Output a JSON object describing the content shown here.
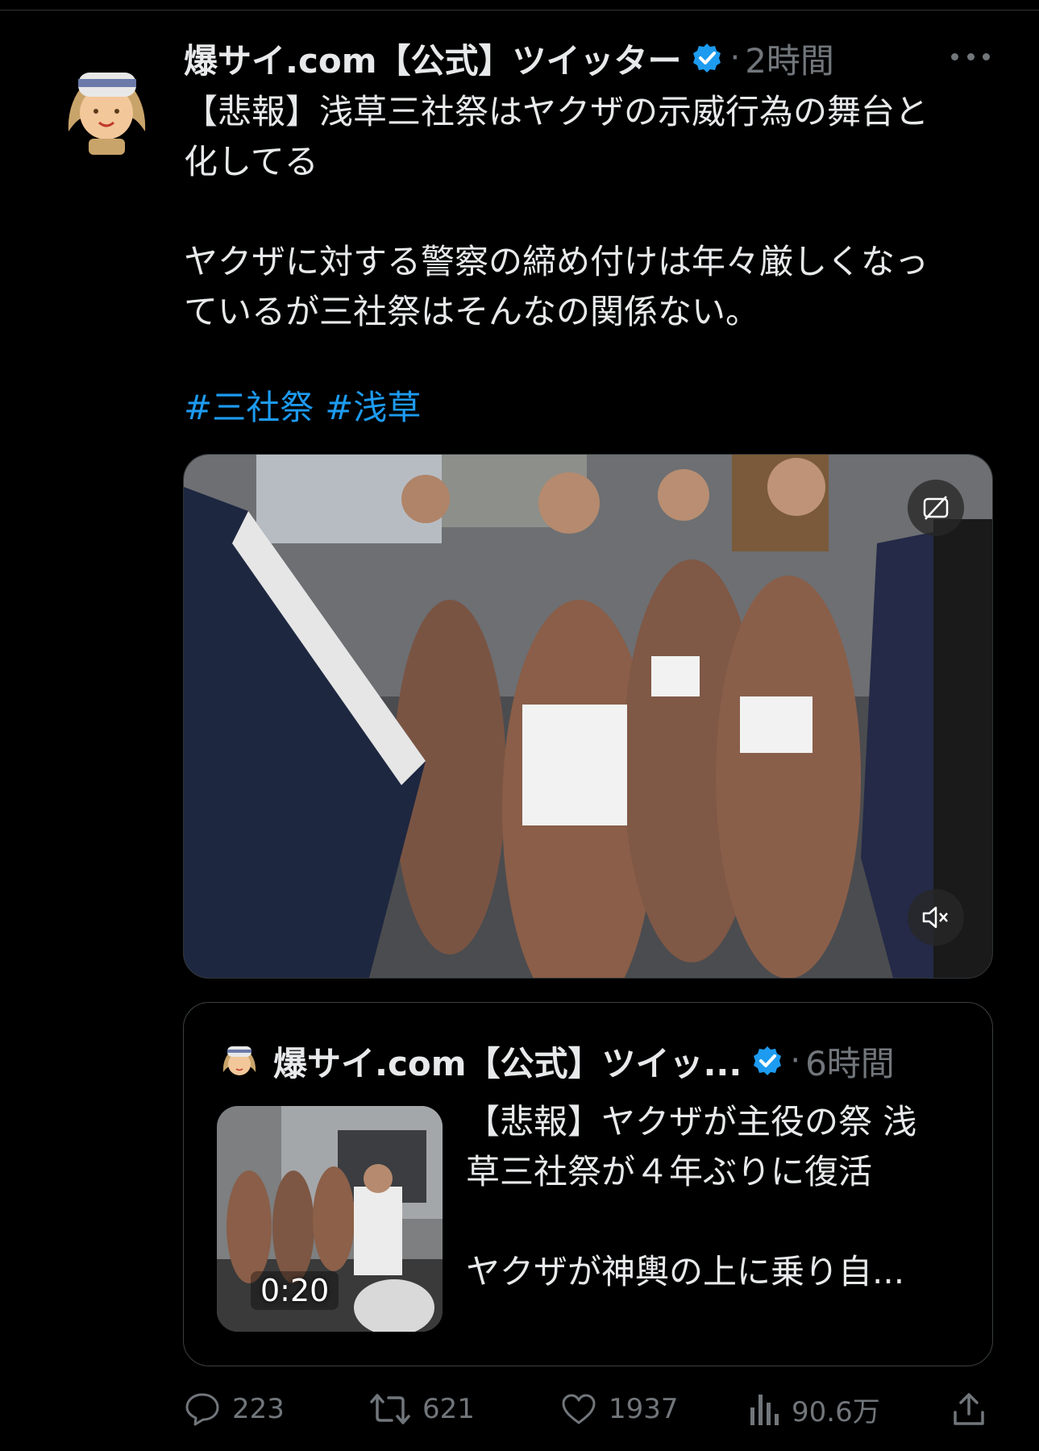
{
  "tweet": {
    "author": "爆サイ.com【公式】ツイッター",
    "dot": "·",
    "time": "2時間",
    "text_lines": [
      "【悲報】浅草三社祭はヤクザの示威行為の舞台と",
      "化してる",
      "",
      "ヤクザに対する警察の締め付けは年々厳しくなっ",
      "ているが三社祭はそんなの関係ない。"
    ],
    "hashtags": [
      "#三社祭",
      "#浅草"
    ]
  },
  "video": {
    "caption_button": "captions-off-icon",
    "mute_button": "volume-muted-icon"
  },
  "quote": {
    "author": "爆サイ.com【公式】ツイッ...",
    "dot": "·",
    "time": "6時間",
    "duration": "0:20",
    "text_lines": [
      "【悲報】ヤクザが主役の祭 浅",
      "草三社祭が４年ぶりに復活",
      "",
      "ヤクザが神輿の上に乗り自..."
    ]
  },
  "actions": {
    "replies": "223",
    "retweets": "621",
    "likes": "1937",
    "views": "90.6万"
  },
  "colors": {
    "background": "#000000",
    "text": "#e7e9ea",
    "muted": "#71767b",
    "link": "#1d9bf0",
    "verified": "#1d9bf0"
  }
}
